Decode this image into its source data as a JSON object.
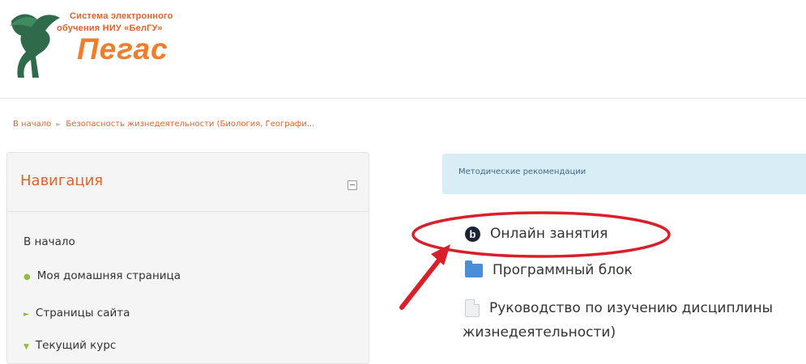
{
  "logo": {
    "line1": "Система электронного",
    "line2": "обучения НИУ «БелГУ»",
    "name": "Пегас"
  },
  "breadcrumb": {
    "home": "В начало",
    "course": "Безопасность жизнедеятельности (Биология, Географи..."
  },
  "navigation": {
    "title": "Навигация",
    "items": [
      {
        "label": "В начало"
      },
      {
        "label": "Моя домашняя страница"
      },
      {
        "label": "Страницы сайта"
      },
      {
        "label": "Текущий курс"
      }
    ]
  },
  "main": {
    "notice": "Методические рекомендации",
    "activities": [
      {
        "label": "Онлайн занятия",
        "icon": "bigbluebutton-icon"
      },
      {
        "label": "Программный блок",
        "icon": "folder-icon"
      },
      {
        "label": "Руководство по изучению дисциплины",
        "icon": "file-icon"
      }
    ],
    "activity3_wrap": "жизнедеятельности)"
  },
  "colors": {
    "accent": "#e0632a",
    "notice_bg": "#d9edf7",
    "annotation": "#d9202a"
  }
}
